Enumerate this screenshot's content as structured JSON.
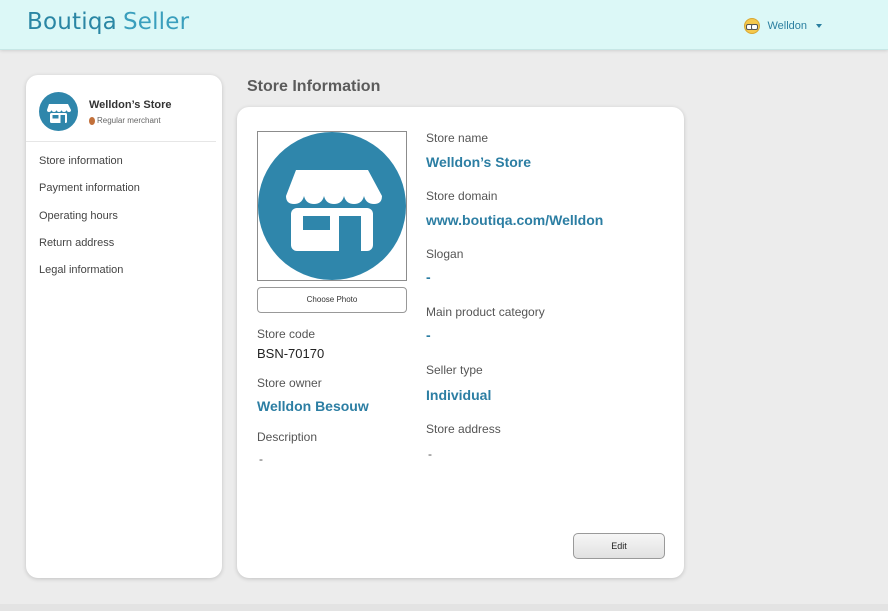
{
  "header": {
    "brand_primary": "Boutiqa",
    "brand_secondary": "Seller",
    "user_name": "Welldon",
    "avatar_icon": "nerd-face-icon",
    "colors": {
      "bar_bg": "#dcf8f7",
      "brand": "#2a86a4",
      "link": "#2c7ea3"
    }
  },
  "sidebar": {
    "store_name": "Welldon’s Store",
    "merchant_level": "Regular merchant",
    "items": [
      {
        "label": "Store information"
      },
      {
        "label": "Payment information"
      },
      {
        "label": "Operating hours"
      },
      {
        "label": "Return address"
      },
      {
        "label": "Legal information"
      }
    ]
  },
  "main": {
    "title": "Store Information",
    "choose_photo_label": "Choose Photo",
    "store_code_label": "Store code",
    "store_code": "BSN-70170",
    "store_owner_label": "Store owner",
    "store_owner": "Welldon Besouw",
    "description_label": "Description",
    "description": "-",
    "store_name_label": "Store name",
    "store_name": "Welldon’s Store",
    "store_domain_label": "Store domain",
    "store_domain": "www.boutiqa.com/Welldon",
    "slogan_label": "Slogan",
    "slogan": "-",
    "category_label": "Main product category",
    "category": "-",
    "seller_type_label": "Seller type",
    "seller_type": "Individual",
    "store_address_label": "Store address",
    "store_address": "-",
    "edit_label": "Edit"
  }
}
